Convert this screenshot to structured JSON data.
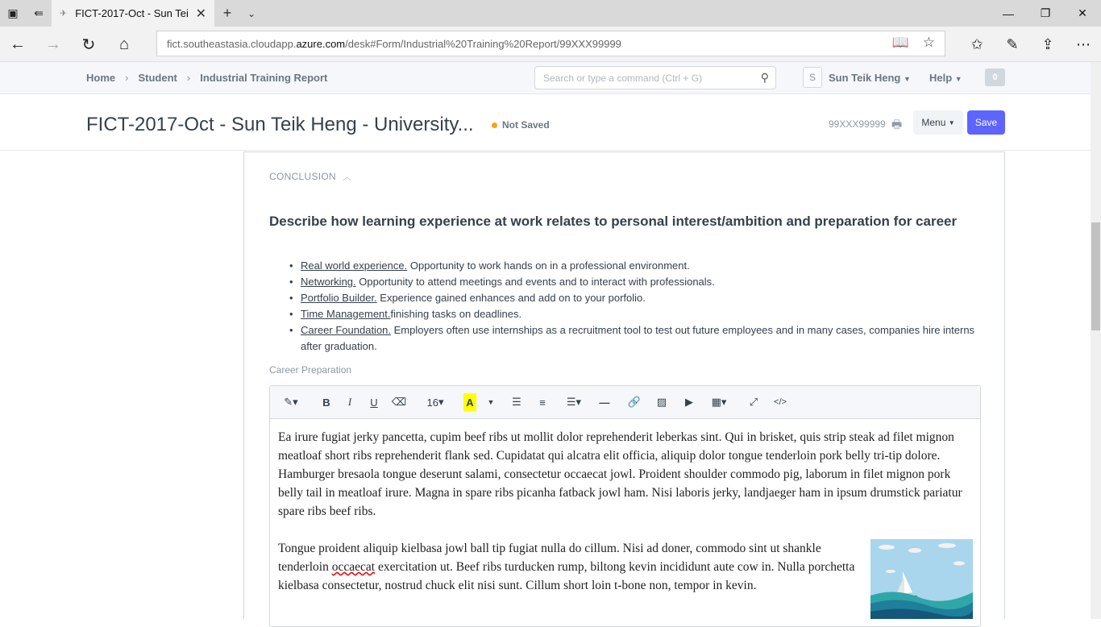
{
  "browser": {
    "tab_title": "FICT-2017-Oct - Sun Tei",
    "url_prefix": "fict.southeastasia.cloudapp.",
    "url_domain": "azure.com",
    "url_path": "/desk#Form/Industrial%20Training%20Report/99XXX99999"
  },
  "breadcrumbs": [
    "Home",
    "Student",
    "Industrial Training Report"
  ],
  "search": {
    "placeholder": "Search or type a command (Ctrl + G)"
  },
  "user": {
    "initial": "S",
    "name": "Sun Teik Heng"
  },
  "help_label": "Help",
  "notifications_count": "0",
  "page": {
    "title": "FICT-2017-Oct - Sun Teik Heng - University...",
    "status": "Not Saved",
    "doc_id": "99XXX99999",
    "menu_label": "Menu",
    "save_label": "Save"
  },
  "section": {
    "heading": "CONCLUSION",
    "question": "Describe how learning experience at work relates to personal interest/ambition and preparation for career",
    "bullets": [
      {
        "term": "Real world experience.",
        "text": " Opportunity to work hands on in a professional environment."
      },
      {
        "term": "Networking.",
        "text": " Opportunity to attend meetings and events and to interact with professionals."
      },
      {
        "term": "Portfolio Builder.",
        "text": " Experience gained enhances and add on to your porfolio."
      },
      {
        "term": "Time Management.",
        "text": "finishing tasks on deadlines."
      },
      {
        "term": "Career Foundation.",
        "text": " Employers often use internships as a recruitment tool to test out future employees and in many cases, companies hire interns after graduation."
      }
    ],
    "field_label": "Career Preparation"
  },
  "editor": {
    "font_size": "16",
    "para1": "Ea irure fugiat jerky pancetta, cupim beef ribs ut mollit dolor reprehenderit leberkas sint. Qui in brisket, quis strip steak ad filet mignon meatloaf short ribs reprehenderit flank sed. Cupidatat qui alcatra elit officia, aliquip dolor tongue tenderloin pork belly tri-tip dolore. Hamburger bresaola tongue deserunt salami, consectetur occaecat jowl. Proident shoulder commodo pig, laborum in filet mignon pork belly tail in meatloaf irure. Magna in spare ribs picanha fatback jowl ham. Nisi laboris jerky, landjaeger ham in ipsum drumstick pariatur spare ribs beef ribs.",
    "para2_a": "Tongue proident aliquip kielbasa jowl ball tip fugiat nulla do cillum. Nisi ad doner, commodo sint ut shankle tenderloin ",
    "para2_misspelled": "occaecat",
    "para2_b": " exercitation ut. Beef ribs turducken rump, biltong kevin incididunt aute cow in. Nulla porchetta kielbasa consectetur, nostrud chuck elit nisi sunt. Cillum short loin t-bone non, tempor in kevin."
  },
  "colors": {
    "primary": "#5e64ff",
    "indicator": "#ffa00a",
    "text": "#36414c"
  }
}
